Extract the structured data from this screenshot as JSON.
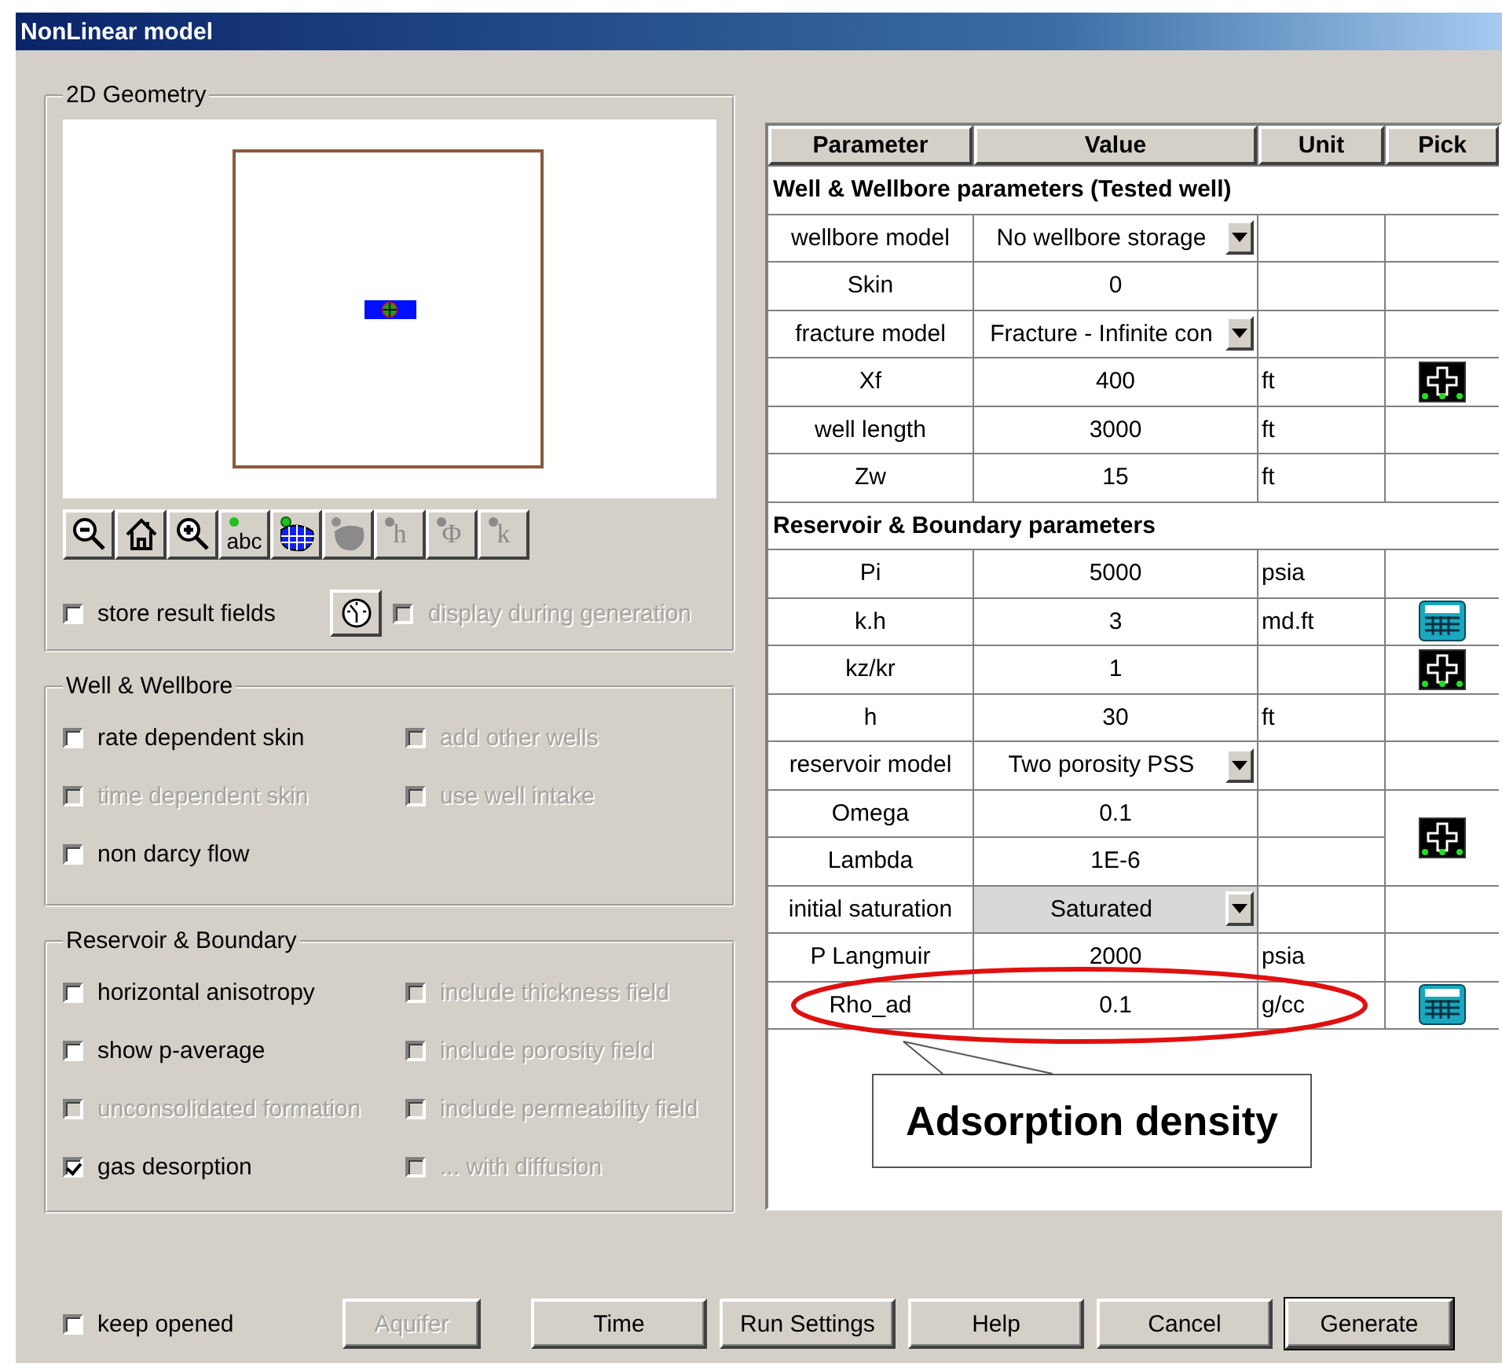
{
  "window": {
    "title": "NonLinear model"
  },
  "geometry": {
    "title": "2D Geometry",
    "tools": [
      {
        "kind": "zoom-out"
      },
      {
        "kind": "home"
      },
      {
        "kind": "zoom-in"
      },
      {
        "kind": "label",
        "text": "abc",
        "disabled": false
      },
      {
        "kind": "grid"
      },
      {
        "kind": "blob",
        "disabled": true
      },
      {
        "kind": "field",
        "text": "h",
        "disabled": true
      },
      {
        "kind": "field",
        "text": "Φ",
        "disabled": true
      },
      {
        "kind": "field",
        "text": "k",
        "disabled": true
      }
    ],
    "options": [
      {
        "kind": "checkbox",
        "label": "store result fields",
        "checked": false,
        "disabled": false
      },
      {
        "kind": "gauge-button"
      },
      {
        "kind": "checkbox",
        "label": "display during generation",
        "checked": false,
        "disabled": true
      }
    ]
  },
  "well_group": {
    "title": "Well & Wellbore",
    "options": [
      {
        "label": "rate dependent skin",
        "checked": false,
        "disabled": false
      },
      {
        "label": "add other wells",
        "checked": false,
        "disabled": true
      },
      {
        "label": "time dependent skin",
        "checked": false,
        "disabled": true
      },
      {
        "label": "use well intake",
        "checked": false,
        "disabled": true
      },
      {
        "label": "non darcy flow",
        "checked": false,
        "disabled": false
      }
    ]
  },
  "reservoir_group": {
    "title": "Reservoir & Boundary",
    "options": [
      {
        "label": "horizontal anisotropy",
        "checked": false,
        "disabled": false
      },
      {
        "label": "include thickness field",
        "checked": false,
        "disabled": true
      },
      {
        "label": "show p-average",
        "checked": false,
        "disabled": false
      },
      {
        "label": "include porosity field",
        "checked": false,
        "disabled": true
      },
      {
        "label": "unconsolidated formation",
        "checked": false,
        "disabled": true
      },
      {
        "label": "include permeability field",
        "checked": false,
        "disabled": true
      },
      {
        "label": "gas desorption",
        "checked": true,
        "disabled": false
      },
      {
        "label": "... with diffusion",
        "checked": false,
        "disabled": true
      }
    ]
  },
  "table": {
    "columns": [
      "Parameter",
      "Value",
      "Unit",
      "Pick"
    ],
    "rows": [
      {
        "kind": "section",
        "label": "Well & Wellbore parameters (Tested well)"
      },
      {
        "kind": "dropdown",
        "name": "wellbore model",
        "value": "No wellbore storage",
        "shaded": false
      },
      {
        "kind": "param",
        "name": "Skin",
        "value": "0"
      },
      {
        "kind": "dropdown",
        "name": "fracture model",
        "value": "Fracture - Infinite con",
        "shaded": false
      },
      {
        "kind": "param",
        "name": "Xf",
        "value": "400",
        "unit": "ft",
        "pick": {
          "kind": "plus"
        }
      },
      {
        "kind": "param",
        "name": "well length",
        "value": "3000",
        "unit": "ft"
      },
      {
        "kind": "param",
        "name": "Zw",
        "value": "15",
        "unit": "ft"
      },
      {
        "kind": "section",
        "label": "Reservoir & Boundary parameters"
      },
      {
        "kind": "param",
        "name": "Pi",
        "value": "5000",
        "unit": "psia"
      },
      {
        "kind": "param",
        "name": "k.h",
        "value": "3",
        "unit": "md.ft",
        "pick": {
          "kind": "calculator"
        }
      },
      {
        "kind": "param",
        "name": "kz/kr",
        "value": "1",
        "pick": {
          "kind": "plus"
        }
      },
      {
        "kind": "param",
        "name": "h",
        "value": "30",
        "unit": "ft"
      },
      {
        "kind": "dropdown",
        "name": "reservoir model",
        "value": "Two porosity PSS",
        "shaded": false
      },
      {
        "kind": "param",
        "name": "Omega",
        "value": "0.1",
        "pick": {
          "kind": "plus"
        },
        "pick_shared_with_next": true
      },
      {
        "kind": "param",
        "name": "Lambda",
        "value": "1E-6"
      },
      {
        "kind": "dropdown",
        "name": "initial saturation",
        "value": "Saturated",
        "shaded": true
      },
      {
        "kind": "param",
        "name": "P Langmuir",
        "value": "2000",
        "unit": "psia"
      },
      {
        "kind": "param",
        "name": "Rho_ad",
        "value": "0.1",
        "unit": "g/cc",
        "pick": {
          "kind": "calculator"
        },
        "highlighted": true
      }
    ]
  },
  "annotation": {
    "text": "Adsorption density"
  },
  "keep_opened": {
    "label": "keep opened",
    "checked": false
  },
  "buttons": [
    {
      "label": "Aquifer",
      "disabled": true,
      "default": false
    },
    {
      "label": "Time",
      "disabled": false,
      "default": false
    },
    {
      "label": "Run Settings",
      "disabled": false,
      "default": false
    },
    {
      "label": "Help",
      "disabled": false,
      "default": false
    },
    {
      "label": "Cancel",
      "disabled": false,
      "default": false
    },
    {
      "label": "Generate",
      "disabled": false,
      "default": true
    }
  ]
}
